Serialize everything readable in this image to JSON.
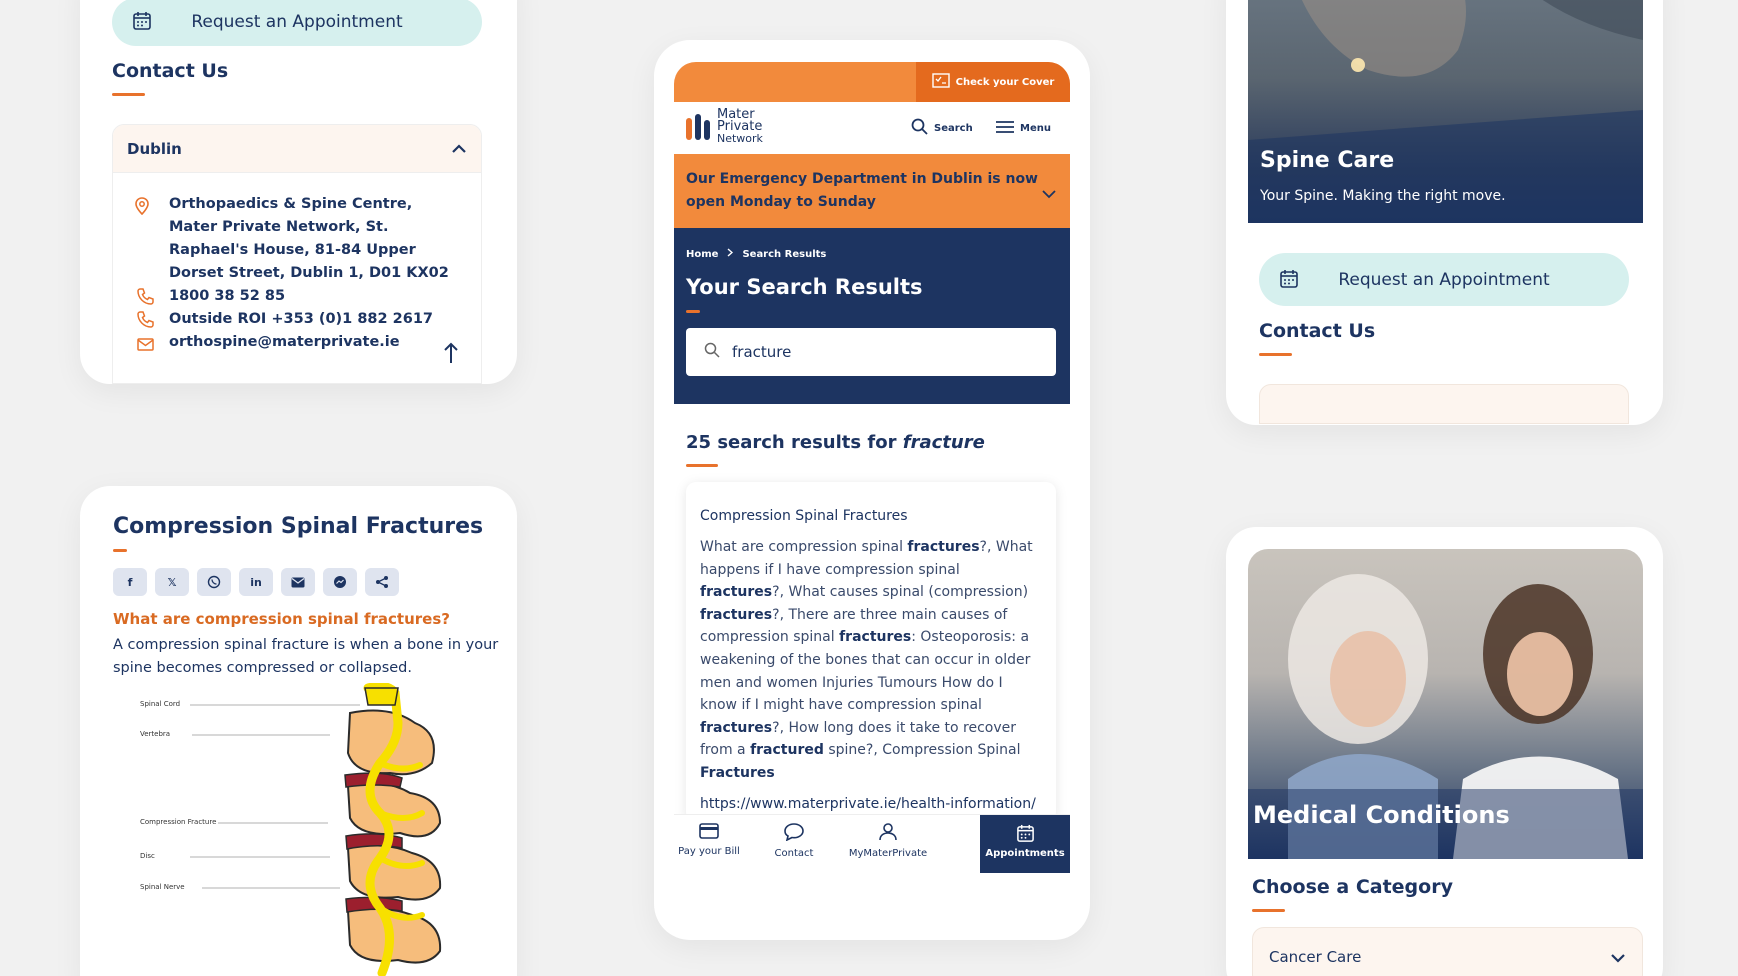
{
  "left_top": {
    "appointment_label": "Request an Appointment",
    "contact_title": "Contact Us",
    "location": "Dublin",
    "address": "Orthopaedics & Spine Centre, Mater Private Network, St. Raphael's House, 81-84 Upper Dorset Street, Dublin 1, D01 KX02",
    "phone": "1800 38 52 85",
    "phone_outside": "Outside ROI +353 (0)1 882 2617",
    "email": "orthospine@materprivate.ie"
  },
  "left_bottom": {
    "title": "Compression Spinal Fractures",
    "share_buttons": [
      "f",
      "𝕏",
      "wa",
      "in",
      "mail",
      "msg",
      "share"
    ],
    "question": "What are compression spinal fractures?",
    "answer": "A compression spinal fracture is when a bone in your spine becomes compressed or collapsed.",
    "diagram_labels": {
      "spinal_cord": "Spinal Cord",
      "vertebra": "Vertebra",
      "compression_fracture": "Compression Fracture",
      "disc": "Disc",
      "spinal_nerve": "Spinal Nerve"
    }
  },
  "phone": {
    "check_cover": "Check your Cover",
    "logo_line1": "Mater",
    "logo_line2": "Private",
    "logo_line3": "Network",
    "search_label": "Search",
    "menu_label": "Menu",
    "alert": "Our Emergency Department in Dublin is now open Monday to Sunday",
    "breadcrumb_home": "Home",
    "breadcrumb_current": "Search Results",
    "page_title": "Your Search Results",
    "search_value": "fracture",
    "results_count_prefix": "25 search results for",
    "results_query": "fracture",
    "result_title": "Compression Spinal Fractures",
    "result_snippet_parts": [
      {
        "t": "What are compression spinal ",
        "b": false
      },
      {
        "t": "fractures",
        "b": true
      },
      {
        "t": "?, What happens if I have compression spinal ",
        "b": false
      },
      {
        "t": "fractures",
        "b": true
      },
      {
        "t": "?, What causes spinal (compression) ",
        "b": false
      },
      {
        "t": "fractures",
        "b": true
      },
      {
        "t": "?, There are three main causes of compression spinal ",
        "b": false
      },
      {
        "t": "fractures",
        "b": true
      },
      {
        "t": ": Osteoporosis: a weakening of the bones that can occur in older men and women Injuries Tumours How do I know if I might have compression spinal ",
        "b": false
      },
      {
        "t": "fractures",
        "b": true
      },
      {
        "t": "?, How long does it take to recover from a ",
        "b": false
      },
      {
        "t": "fractured",
        "b": true
      },
      {
        "t": " spine?, Compression Spinal ",
        "b": false
      },
      {
        "t": "Fractures",
        "b": true
      }
    ],
    "result_url": "https://www.materprivate.ie/health-information/medical-conditions/article/spine-",
    "nav": [
      "Pay your Bill",
      "Contact",
      "MyMaterPrivate",
      "Appointments"
    ]
  },
  "right_top": {
    "hero_title": "Spine Care",
    "hero_subtitle": "Your Spine. Making the right move.",
    "appointment_label": "Request an Appointment",
    "contact_title": "Contact Us"
  },
  "right_bottom": {
    "hero_title": "Medical Conditions",
    "category_title": "Choose a Category",
    "category_value": "Cancer Care"
  },
  "colors": {
    "navy": "#1d3461",
    "orange": "#e8722c",
    "mint": "#d6f0ee"
  }
}
